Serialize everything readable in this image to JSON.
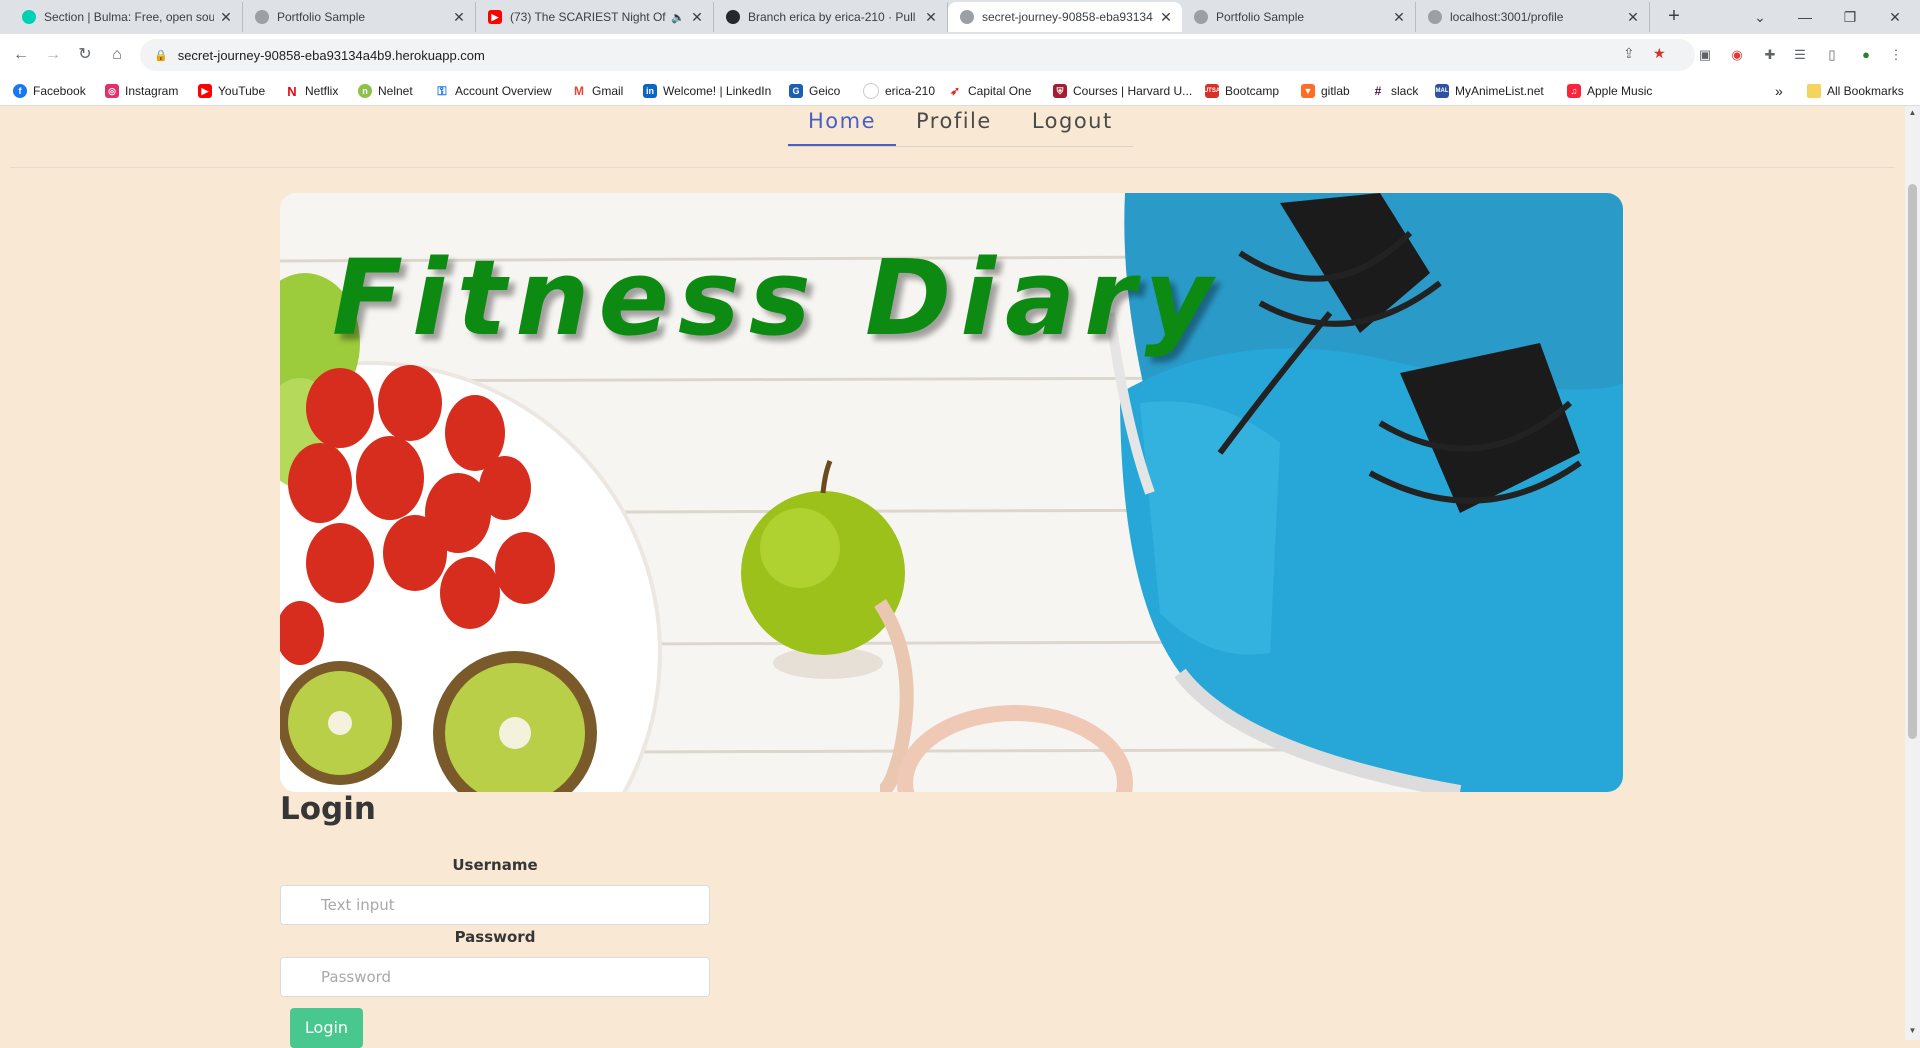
{
  "browser": {
    "tabs": [
      {
        "title": "Section | Bulma: Free, open sou",
        "favicon": "bulma-icon",
        "color": "#00d1b2"
      },
      {
        "title": "Portfolio Sample",
        "favicon": "globe-icon",
        "color": "#9aa0a6"
      },
      {
        "title": "(73) The SCARIEST Night Of",
        "favicon": "youtube-icon",
        "color": "#ff0000"
      },
      {
        "title": "Branch erica by erica-210 · Pull",
        "favicon": "github-icon",
        "color": "#24292f"
      },
      {
        "title": "secret-journey-90858-eba93134",
        "favicon": "globe-icon",
        "color": "#9aa0a6"
      },
      {
        "title": "Portfolio Sample",
        "favicon": "globe-icon",
        "color": "#9aa0a6"
      },
      {
        "title": "localhost:3001/profile",
        "favicon": "globe-icon",
        "color": "#9aa0a6"
      }
    ],
    "active_tab": 4,
    "url": "secret-journey-90858-eba93134a4b9.herokuapp.com",
    "bookmarks": [
      {
        "label": "Facebook",
        "icon": "facebook-icon",
        "color": "#1877f2"
      },
      {
        "label": "Instagram",
        "icon": "instagram-icon",
        "color": "#e1306c"
      },
      {
        "label": "YouTube",
        "icon": "youtube-icon",
        "color": "#ff0000"
      },
      {
        "label": "Netflix",
        "icon": "netflix-icon",
        "color": "#e50914"
      },
      {
        "label": "Nelnet",
        "icon": "nelnet-icon",
        "color": "#8bc34a"
      },
      {
        "label": "Account Overview",
        "icon": "key-icon",
        "color": "#1a73e8"
      },
      {
        "label": "Gmail",
        "icon": "gmail-icon",
        "color": "#ea4335"
      },
      {
        "label": "Welcome! | LinkedIn",
        "icon": "linkedin-icon",
        "color": "#0a66c2"
      },
      {
        "label": "Geico",
        "icon": "geico-icon",
        "color": "#1a5fb4"
      },
      {
        "label": "erica-210",
        "icon": "github-icon",
        "color": "#24292f"
      },
      {
        "label": "Capital One",
        "icon": "capitalone-icon",
        "color": "#d03027"
      },
      {
        "label": "Courses | Harvard U...",
        "icon": "harvard-icon",
        "color": "#a51c30"
      },
      {
        "label": "Bootcamp",
        "icon": "bootcamp-icon",
        "color": "#d93025"
      },
      {
        "label": "gitlab",
        "icon": "gitlab-icon",
        "color": "#fc6d26"
      },
      {
        "label": "slack",
        "icon": "slack-icon",
        "color": "#4a154b"
      },
      {
        "label": "MyAnimeList.net",
        "icon": "mal-icon",
        "color": "#2e51a2"
      },
      {
        "label": "Apple Music",
        "icon": "apple-music-icon",
        "color": "#fa243c"
      }
    ],
    "all_bookmarks": "All Bookmarks",
    "overflow_chevron": "»"
  },
  "site": {
    "nav": [
      {
        "label": "Home",
        "active": true
      },
      {
        "label": "Profile",
        "active": false
      },
      {
        "label": "Logout",
        "active": false
      }
    ],
    "hero_title": "Fitness Diary",
    "login": {
      "heading": "Login",
      "username_label": "Username",
      "username_placeholder": "Text input",
      "password_label": "Password",
      "password_placeholder": "Password",
      "button": "Login"
    }
  },
  "colors": {
    "page_bg": "#f9e9d4",
    "nav_active": "#485fc7",
    "hero_title": "#0d8a12",
    "login_button": "#48c78e"
  }
}
